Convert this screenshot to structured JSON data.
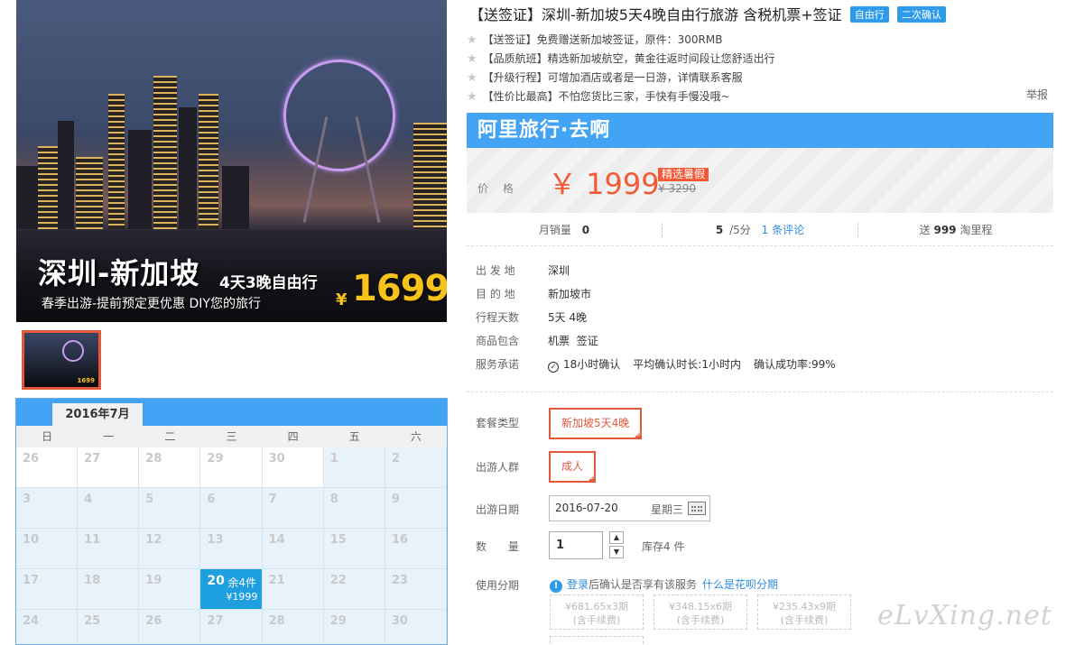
{
  "hero": {
    "title": "深圳-新加坡",
    "subtitle": "4天3晚自由行",
    "tagline": "春季出游-提前预定更优惠 DIY您的旅行",
    "yen": "¥",
    "price": "1699"
  },
  "thumbs": {
    "first_label": "1699"
  },
  "calendar": {
    "month": "2016年7月",
    "weekdays": [
      "日",
      "一",
      "二",
      "三",
      "四",
      "五",
      "六"
    ],
    "highlight": {
      "stock": "余4件",
      "price": "¥1999"
    },
    "days": [
      "26",
      "27",
      "28",
      "29",
      "30",
      "1",
      "2",
      "3",
      "4",
      "5",
      "6",
      "7",
      "8",
      "9",
      "10",
      "11",
      "12",
      "13",
      "14",
      "15",
      "16",
      "17",
      "18",
      "19",
      "20",
      "21",
      "22",
      "23",
      "24",
      "25",
      "26",
      "27",
      "28",
      "29",
      "30"
    ]
  },
  "product": {
    "title": "【送签证】深圳-新加坡5天4晚自由行旅游 含税机票+签证",
    "badges": [
      "自由行",
      "二次确认"
    ],
    "features": [
      "【送签证】免费赠送新加坡签证，原件：300RMB",
      "【品质航班】精选新加坡航空，黄金往返时间段让您舒适出行",
      "【升级行程】可增加酒店或者是一日游，详情联系客服",
      "【性价比最高】不怕您货比三家，手快有手慢没哦~"
    ],
    "report": "举报"
  },
  "price": {
    "brand": "阿里旅行·去啊",
    "label": "价 格",
    "current": "￥ 1999",
    "promo": "精选暑假",
    "original": "¥ 3290"
  },
  "stats": {
    "monthly_sales_label": "月销量",
    "monthly_sales": "0",
    "rating": "5",
    "rating_suffix": "/5分",
    "reviews": "1 条评论",
    "points_prefix": "送",
    "points": "999",
    "points_suffix": "淘里程"
  },
  "info": {
    "rows": [
      {
        "k": "出 发 地",
        "v": "深圳"
      },
      {
        "k": "目 的 地",
        "v": "新加坡市"
      },
      {
        "k": "行程天数",
        "v": "5天 4晚"
      },
      {
        "k": "商品包含",
        "v": "机票  签证"
      }
    ],
    "service_label": "服务承诺",
    "service_1": "18小时确认",
    "service_2": "平均确认时长:1小时内",
    "service_3": "确认成功率:99%"
  },
  "options": {
    "package_label": "套餐类型",
    "package_value": "新加坡5天4晚",
    "people_label": "出游人群",
    "people_value": "成人",
    "date_label": "出游日期",
    "date_value": "2016-07-20",
    "date_week": "星期三",
    "qty_label": "数 量",
    "qty_value": "1",
    "stock": "库存4 件",
    "instal_label": "使用分期",
    "instal_login": "登录",
    "instal_text": "后确认是否享有该服务",
    "instal_link": "什么是花呗分期",
    "instal_plans": [
      {
        "amount": "¥681.65x3期",
        "note": "(含手续费)"
      },
      {
        "amount": "¥348.15x6期",
        "note": "(含手续费)"
      },
      {
        "amount": "¥235.43x9期",
        "note": "(含手续费)"
      }
    ]
  },
  "watermark": "eLvXing.net"
}
